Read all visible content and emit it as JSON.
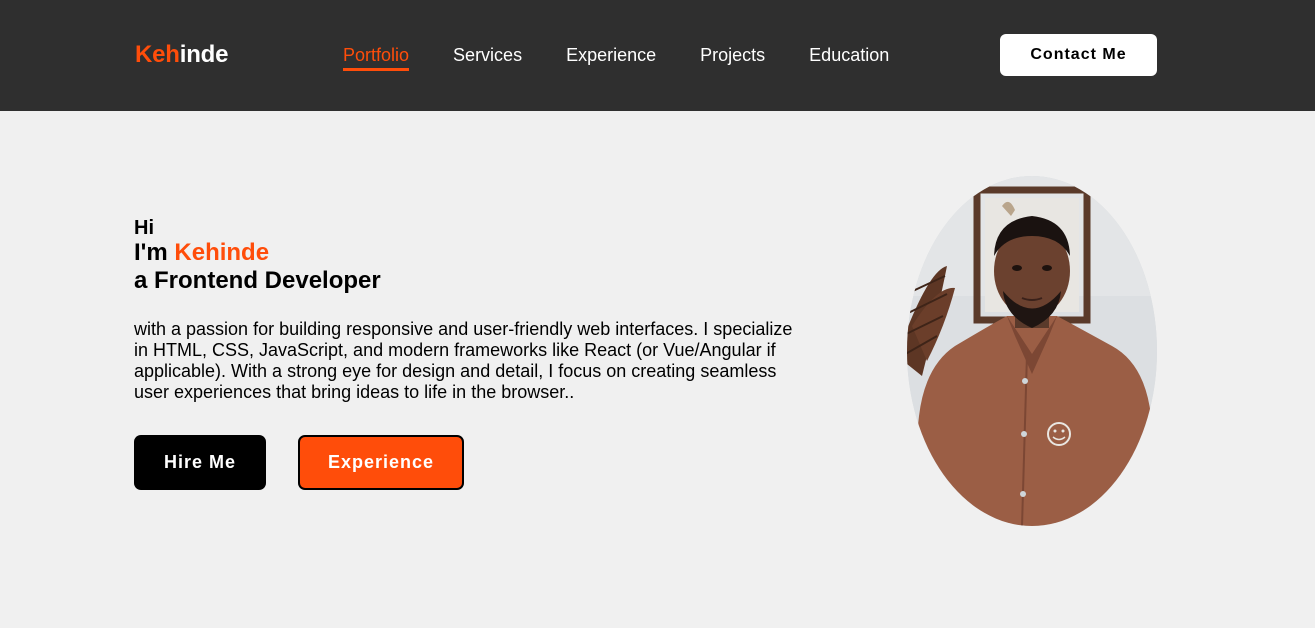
{
  "header": {
    "logo_part1": "Keh",
    "logo_part2": "inde",
    "nav": [
      "Portfolio",
      "Services",
      "Experience",
      "Projects",
      "Education"
    ],
    "active_nav": "Portfolio",
    "contact_label": "Contact Me"
  },
  "hero": {
    "greeting": "Hi",
    "intro_prefix": "I'm ",
    "name": "Kehinde",
    "role": "a Frontend Developer",
    "description": "with a passion for building responsive and user-friendly web interfaces. I specialize in HTML, CSS, JavaScript, and modern frameworks like React (or Vue/Angular if applicable). With a strong eye for design and detail, I focus on creating seamless user experiences that bring ideas to life in the browser..",
    "hire_label": "Hire Me",
    "experience_label": "Experience"
  },
  "colors": {
    "accent": "#ff4d0a",
    "navbar_bg": "#2f2f2f",
    "page_bg": "#f0f0f0"
  }
}
